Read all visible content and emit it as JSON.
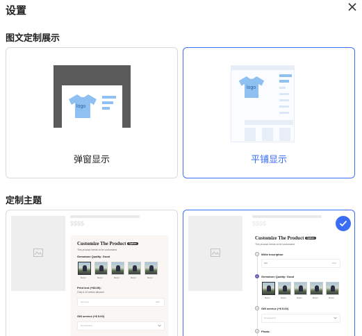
{
  "dialog": {
    "title": "设置"
  },
  "display_section": {
    "label": "图文定制展示",
    "options": [
      {
        "label": "弹窗显示",
        "selected": false,
        "logo_text": "logo"
      },
      {
        "label": "平铺显示",
        "selected": true,
        "logo_text": "logo"
      }
    ]
  },
  "theme_section": {
    "label": "定制主题",
    "themes": [
      {
        "selected": false,
        "price": "$$$$",
        "product_title": "Customize The Product",
        "badge": "Option",
        "subtitle": "This product needs to be customized",
        "gemstone_label": "Gemstone Quality: Good",
        "thumb_captions": [
          "Better",
          "Better",
          "Better",
          "Better",
          "Better"
        ],
        "print_label": "Print text (+$5.00):",
        "print_hint": "Only 6-10 letters allowed",
        "print_placeholder": "Text here",
        "print_counter": "0/20",
        "gift_label": "Gift service (+$ 5.00)",
        "gift_placeholder": "Not selected"
      },
      {
        "selected": true,
        "price": "$$$$",
        "product_title": "Customize The Product",
        "badge": "Option",
        "subtitle": "This product needs to be customized",
        "step1_label": "Write inscription",
        "step1_value": "Gift",
        "step1_counter": "0/20",
        "gemstone_label": "Gemstone Quality: Good",
        "thumb_captions": [
          "Better",
          "Better",
          "Better",
          "Better",
          "Better"
        ],
        "gift_label": "Gift service (+$ 5.00)",
        "gift_placeholder": "Not selected",
        "photo_label": "Photo:"
      }
    ]
  },
  "colors": {
    "accent": "#3b6cf6",
    "border": "#d9d9d9",
    "step_active": "#6b5ab1"
  }
}
